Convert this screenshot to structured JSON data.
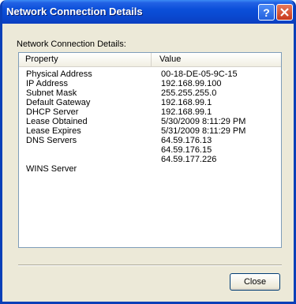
{
  "window": {
    "title": "Network Connection Details",
    "help_label": "?",
    "close_label": "X"
  },
  "dialog": {
    "heading": "Network Connection Details:",
    "close_button_label": "Close"
  },
  "table": {
    "columns": [
      "Property",
      "Value"
    ],
    "rows": [
      {
        "property": "Physical Address",
        "value": "00-18-DE-05-9C-15"
      },
      {
        "property": "IP Address",
        "value": "192.168.99.100"
      },
      {
        "property": "Subnet Mask",
        "value": "255.255.255.0"
      },
      {
        "property": "Default Gateway",
        "value": "192.168.99.1"
      },
      {
        "property": "DHCP Server",
        "value": "192.168.99.1"
      },
      {
        "property": "Lease Obtained",
        "value": "5/30/2009 8:11:29 PM"
      },
      {
        "property": "Lease Expires",
        "value": "5/31/2009 8:11:29 PM"
      },
      {
        "property": "DNS Servers",
        "value": "64.59.176.13"
      },
      {
        "property": "",
        "value": "64.59.176.15"
      },
      {
        "property": "",
        "value": "64.59.177.226"
      },
      {
        "property": "WINS Server",
        "value": ""
      }
    ]
  },
  "colors": {
    "titlebar": "#0b4fd9",
    "dialog_background": "#ece9d8",
    "list_border": "#7f9db9",
    "close_caption": "#c7381b"
  }
}
